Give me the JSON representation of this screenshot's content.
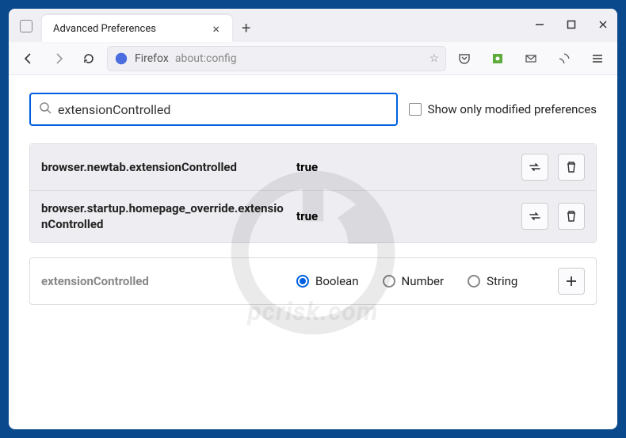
{
  "tab": {
    "title": "Advanced Preferences"
  },
  "toolbar": {
    "identity_label": "Firefox",
    "url": "about:config"
  },
  "search": {
    "value": "extensionControlled",
    "show_modified_label": "Show only modified preferences"
  },
  "results": [
    {
      "name": "browser.newtab.extensionControlled",
      "value": "true"
    },
    {
      "name": "browser.startup.homepage_override.extensionControlled",
      "value": "true"
    }
  ],
  "add": {
    "name": "extensionControlled",
    "types": [
      "Boolean",
      "Number",
      "String"
    ],
    "selected": "Boolean"
  },
  "watermark": "pcrisk.com"
}
